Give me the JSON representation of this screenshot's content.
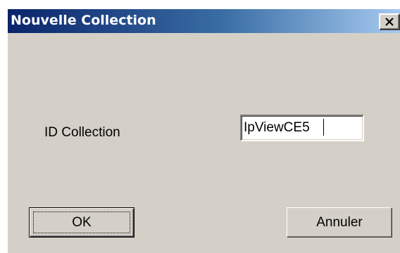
{
  "window": {
    "title": "Nouvelle Collection",
    "close_icon": "close-icon"
  },
  "form": {
    "id_label": "ID Collection",
    "id_value": "IpViewCE5"
  },
  "buttons": {
    "ok_label": "OK",
    "cancel_label": "Annuler"
  },
  "colors": {
    "dialog_face": "#d4d0c8",
    "titlebar_start": "#0a246a",
    "titlebar_end": "#a6caf0",
    "title_text": "#ffffff"
  }
}
